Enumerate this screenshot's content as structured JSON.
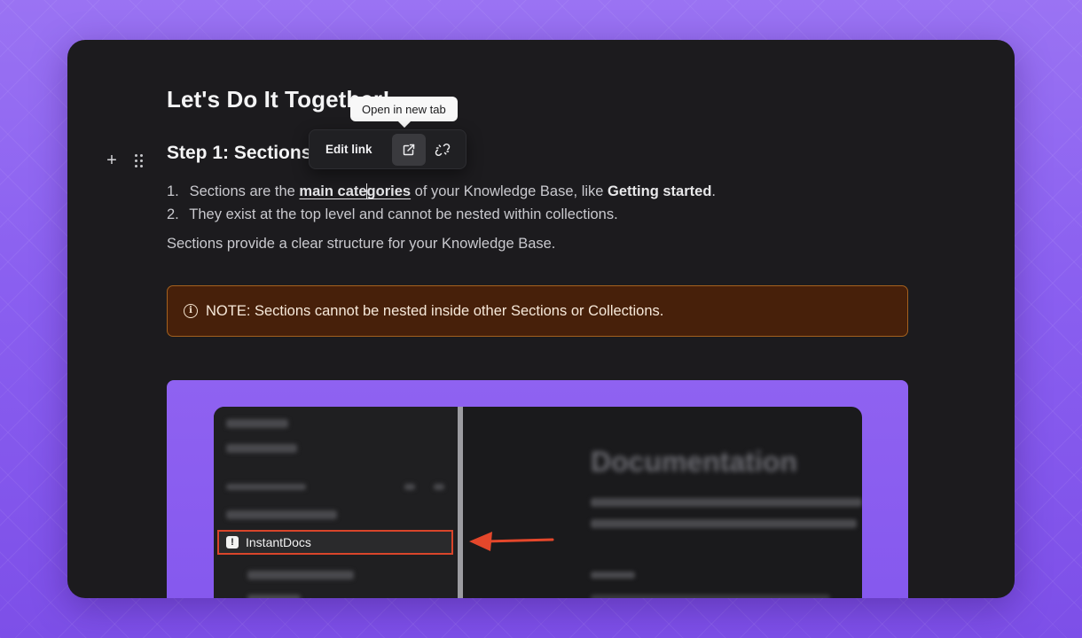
{
  "editor": {
    "page_heading": "Let's Do It Together!",
    "step_heading": "Step 1: Sections",
    "list": [
      {
        "number": "1.",
        "before_link": "Sections are the ",
        "link_before_caret": "main cate",
        "link_after_caret": "gories",
        "after_link": " of your Knowledge Base, like ",
        "bold": "Getting started",
        "end": "."
      },
      {
        "number": "2.",
        "text": "They exist at the top level and cannot be nested within collections."
      }
    ],
    "paragraph": "Sections provide a clear structure for your Knowledge Base.",
    "callout": {
      "text": "NOTE: Sections cannot be nested inside other Sections or Collections.",
      "icon": "info-icon"
    }
  },
  "link_toolbar": {
    "edit_label": "Edit link",
    "open_icon": "external-link-icon",
    "unlink_icon": "unlink-icon",
    "tooltip": "Open in new tab"
  },
  "screenshot_image": {
    "highlighted_item": "InstantDocs",
    "highlight_color": "#d9452b",
    "blurred_title": "Documentation"
  },
  "colors": {
    "background": "#8a5ff0",
    "editor_bg": "#1c1b1e",
    "callout_bg": "#47200a",
    "callout_border": "#a4611e"
  }
}
